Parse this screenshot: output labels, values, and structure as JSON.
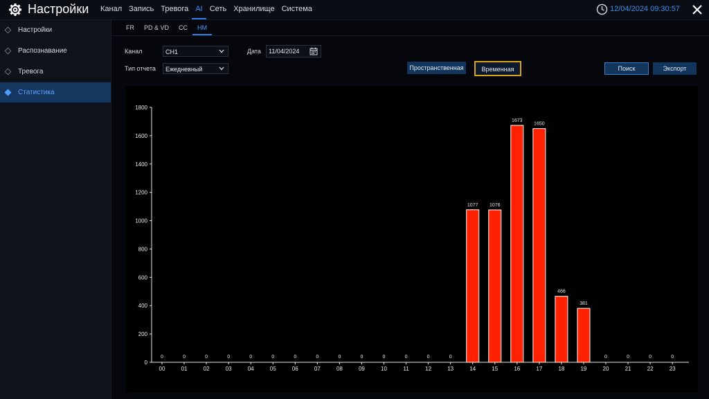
{
  "header": {
    "title": "Настройки",
    "nav": [
      "Канал",
      "Запись",
      "Тревога",
      "AI",
      "Сеть",
      "Хранилище",
      "Система"
    ],
    "active_nav": "AI",
    "datetime": "12/04/2024 09:30:57",
    "accent": "#3d8ef0"
  },
  "sidebar": {
    "items": [
      {
        "label": "Настройки"
      },
      {
        "label": "Распознавание"
      },
      {
        "label": "Тревога"
      },
      {
        "label": "Статистика"
      }
    ],
    "active": "Статистика"
  },
  "subtabs": {
    "items": [
      "FR",
      "PD & VD",
      "CC",
      "HM"
    ],
    "active": "HM"
  },
  "form": {
    "channel_label": "Канал",
    "channel_value": "CH1",
    "date_label": "Дата",
    "date_value": "11/04/2024",
    "report_label": "Тип отчета",
    "report_value": "Ежедневный"
  },
  "buttons": {
    "spatial": "Пространственная",
    "temporal": "Временная",
    "search": "Поиск",
    "export": "Экспорт"
  },
  "chart_data": {
    "type": "bar",
    "categories": [
      "00",
      "01",
      "02",
      "03",
      "04",
      "05",
      "06",
      "07",
      "08",
      "09",
      "10",
      "11",
      "12",
      "13",
      "14",
      "15",
      "16",
      "17",
      "18",
      "19",
      "20",
      "21",
      "22",
      "23"
    ],
    "values": [
      0,
      0,
      0,
      0,
      0,
      0,
      0,
      0,
      0,
      0,
      0,
      0,
      0,
      0,
      1077,
      1076,
      1673,
      1650,
      466,
      381,
      0,
      0,
      0,
      0
    ],
    "ylim": [
      0,
      1800
    ],
    "yticks": [
      0,
      200,
      400,
      600,
      800,
      1000,
      1200,
      1400,
      1600,
      1800
    ],
    "bar_color": "#ff2200",
    "grid": false
  }
}
